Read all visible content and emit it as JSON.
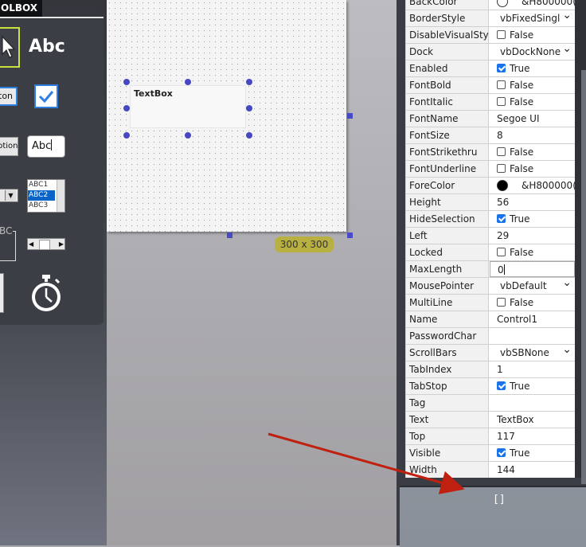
{
  "toolbox": {
    "tab_label": "OLBOX",
    "tools": {
      "label_sample": "Abc",
      "button_sample": "ton",
      "option_sample": "ption",
      "textbox_sample": "Abc",
      "list_items": [
        "ABC1",
        "ABC2",
        "ABC3"
      ],
      "frame_sample": "BC"
    }
  },
  "form": {
    "textbox_label": "TextBox",
    "size_badge": "300 x 300"
  },
  "colors": {
    "accent": "#4747c2",
    "checkbox_on": "#1a73e8",
    "badge": "#b8b040",
    "arrow": "#c0200f"
  },
  "properties": [
    {
      "name": "BackColor",
      "value": "&H800000(",
      "type": "color",
      "color": "#ffffff"
    },
    {
      "name": "BorderStyle",
      "value": "vbFixedSingl",
      "type": "dropdown"
    },
    {
      "name": "DisableVisualStyle",
      "value": "False",
      "type": "check",
      "checked": false
    },
    {
      "name": "Dock",
      "value": "vbDockNone",
      "type": "dropdown"
    },
    {
      "name": "Enabled",
      "value": "True",
      "type": "check",
      "checked": true
    },
    {
      "name": "FontBold",
      "value": "False",
      "type": "check",
      "checked": false
    },
    {
      "name": "FontItalic",
      "value": "False",
      "type": "check",
      "checked": false
    },
    {
      "name": "FontName",
      "value": "Segoe UI",
      "type": "text"
    },
    {
      "name": "FontSize",
      "value": "8",
      "type": "text"
    },
    {
      "name": "FontStrikethru",
      "value": "False",
      "type": "check",
      "checked": false
    },
    {
      "name": "FontUnderline",
      "value": "False",
      "type": "check",
      "checked": false
    },
    {
      "name": "ForeColor",
      "value": "&H800000(",
      "type": "color",
      "color": "#000000"
    },
    {
      "name": "Height",
      "value": "56",
      "type": "text"
    },
    {
      "name": "HideSelection",
      "value": "True",
      "type": "check",
      "checked": true
    },
    {
      "name": "Left",
      "value": "29",
      "type": "text"
    },
    {
      "name": "Locked",
      "value": "False",
      "type": "check",
      "checked": false
    },
    {
      "name": "MaxLength",
      "value": "0",
      "type": "edit"
    },
    {
      "name": "MousePointer",
      "value": "vbDefault",
      "type": "dropdown"
    },
    {
      "name": "MultiLine",
      "value": "False",
      "type": "check",
      "checked": false
    },
    {
      "name": "Name",
      "value": "Control1",
      "type": "text"
    },
    {
      "name": "PasswordChar",
      "value": "",
      "type": "text"
    },
    {
      "name": "ScrollBars",
      "value": "vbSBNone",
      "type": "dropdown"
    },
    {
      "name": "TabIndex",
      "value": "1",
      "type": "text"
    },
    {
      "name": "TabStop",
      "value": "True",
      "type": "check",
      "checked": true
    },
    {
      "name": "Tag",
      "value": "",
      "type": "text"
    },
    {
      "name": "Text",
      "value": "TextBox",
      "type": "text"
    },
    {
      "name": "Top",
      "value": "117",
      "type": "text"
    },
    {
      "name": "Visible",
      "value": "True",
      "type": "check",
      "checked": true
    },
    {
      "name": "Width",
      "value": "144",
      "type": "text"
    }
  ],
  "bottom_panel": {
    "glyph": "[]"
  }
}
